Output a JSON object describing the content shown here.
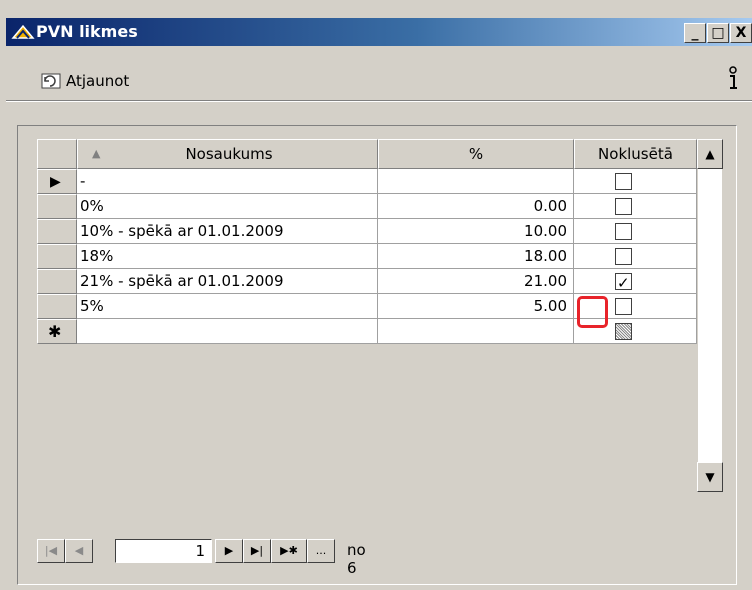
{
  "window": {
    "title": "PVN likmes",
    "controls": {
      "minimize": "_",
      "maximize": "□",
      "close": "X"
    }
  },
  "toolbar": {
    "refresh_label": "Atjaunot",
    "refresh_icon": "refresh-icon",
    "info_icon": "info-icon"
  },
  "grid": {
    "columns": [
      "Nosaukums",
      "%",
      "Noklusētā"
    ],
    "sort_indicator": "▲",
    "rows": [
      {
        "name": "-",
        "percent": "",
        "default": false
      },
      {
        "name": "0%",
        "percent": "0.00",
        "default": false
      },
      {
        "name": "10% - spēkā ar 01.01.2009",
        "percent": "10.00",
        "default": false
      },
      {
        "name": "18%",
        "percent": "18.00",
        "default": false
      },
      {
        "name": "21% - spēkā ar 01.01.2009",
        "percent": "21.00",
        "default": true
      },
      {
        "name": "5%",
        "percent": "5.00",
        "default": false
      }
    ],
    "current_row_marker": "▶",
    "new_row_marker": "✱"
  },
  "navigator": {
    "first": "|◀",
    "prev": "◀",
    "page": "1",
    "next": "▶",
    "last": "▶|",
    "new": "▶✱",
    "more": "...",
    "total_label": "no 6"
  }
}
